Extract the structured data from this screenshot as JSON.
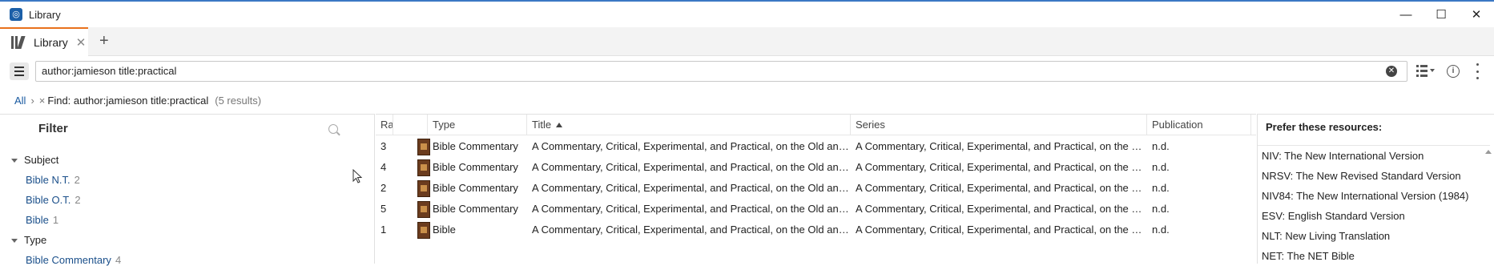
{
  "window": {
    "title": "Library",
    "minimize": "—",
    "maximize": "☐",
    "close": "✕"
  },
  "tabs": [
    {
      "label": "Library",
      "close": "✕"
    }
  ],
  "new_tab": "+",
  "search": {
    "value": "author:jamieson title:practical"
  },
  "breadcrumb": {
    "all": "All",
    "sep": "›",
    "remove": "×",
    "find": "Find: author:jamieson title:practical",
    "count": "(5 results)"
  },
  "filter": {
    "title": "Filter",
    "groups": [
      {
        "label": "Subject",
        "items": [
          {
            "name": "Bible N.T.",
            "count": "2"
          },
          {
            "name": "Bible O.T.",
            "count": "2"
          },
          {
            "name": "Bible",
            "count": "1"
          }
        ]
      },
      {
        "label": "Type",
        "items": [
          {
            "name": "Bible Commentary",
            "count": "4"
          }
        ]
      }
    ]
  },
  "grid": {
    "columns": {
      "rating": "Ra",
      "type": "Type",
      "title": "Title",
      "series": "Series",
      "publication": "Publication"
    },
    "rows": [
      {
        "rating": "3",
        "type": "Bible Commentary",
        "title": "A Commentary, Critical, Experimental, and Practical, on the Old and New Testaments",
        "series": "A Commentary, Critical, Experimental, and Practical, on the Old and New Testaments",
        "publication": "n.d."
      },
      {
        "rating": "4",
        "type": "Bible Commentary",
        "title": "A Commentary, Critical, Experimental, and Practical, on the Old and New Testaments",
        "series": "A Commentary, Critical, Experimental, and Practical, on the Old and New Testaments",
        "publication": "n.d."
      },
      {
        "rating": "2",
        "type": "Bible Commentary",
        "title": "A Commentary, Critical, Experimental, and Practical, on the Old and New Testaments",
        "series": "A Commentary, Critical, Experimental, and Practical, on the Old and New Testaments",
        "publication": "n.d."
      },
      {
        "rating": "5",
        "type": "Bible Commentary",
        "title": "A Commentary, Critical, Experimental, and Practical, on the Old and New Testaments",
        "series": "A Commentary, Critical, Experimental, and Practical, on the Old and New Testaments",
        "publication": "n.d."
      },
      {
        "rating": "1",
        "type": "Bible",
        "title": "A Commentary, Critical, Experimental, and Practical, on the Old and New Testaments",
        "series": "A Commentary, Critical, Experimental, and Practical, on the Old and New Testaments",
        "publication": "n.d."
      }
    ]
  },
  "prefer": {
    "title": "Prefer these resources:",
    "items": [
      "NIV: The New International Version",
      "NRSV: The New Revised Standard Version",
      "NIV84: The New International Version (1984)",
      "ESV: English Standard Version",
      "NLT: New Living Translation",
      "NET: The NET Bible"
    ]
  }
}
